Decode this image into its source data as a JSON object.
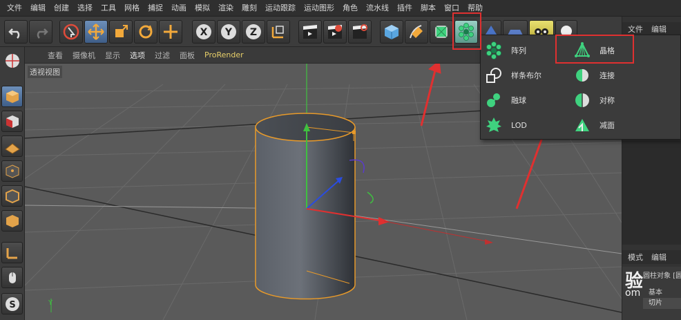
{
  "menu": [
    "文件",
    "编辑",
    "创建",
    "选择",
    "工具",
    "网格",
    "捕捉",
    "动画",
    "模拟",
    "渲染",
    "雕刻",
    "运动跟踪",
    "运动图形",
    "角色",
    "流水线",
    "插件",
    "脚本",
    "窗口",
    "帮助"
  ],
  "viewport_menu": [
    "查看",
    "摄像机",
    "显示",
    "选项",
    "过滤",
    "面板",
    "ProRender"
  ],
  "viewport_label": "透视视图",
  "dropdown": {
    "left": [
      {
        "icon": "array-icon",
        "label": "阵列"
      },
      {
        "icon": "spline-boolean-icon",
        "label": "样条布尔"
      },
      {
        "icon": "metaball-icon",
        "label": "融球"
      },
      {
        "icon": "lod-icon",
        "label": "LOD"
      }
    ],
    "right": [
      {
        "icon": "atom-array-icon",
        "label": "晶格"
      },
      {
        "icon": "connect-icon",
        "label": "连接"
      },
      {
        "icon": "symmetry-icon",
        "label": "对称"
      },
      {
        "icon": "polygon-reduction-icon",
        "label": "减面"
      }
    ]
  },
  "right_panel": {
    "top_tabs": [
      "文件",
      "编辑"
    ],
    "bottom_tabs": [
      "模式",
      "编辑"
    ],
    "object_label": "圆柱对象 [圆",
    "tab_basic": "基本",
    "tab_slice": "切片",
    "watermark_1": "验",
    "watermark_2": "om"
  },
  "axis_labels": {
    "y": "Y"
  },
  "colors": {
    "accent_green": "#3fd27f",
    "highlight_red": "#e03030",
    "prorender": "#e8d06a"
  }
}
